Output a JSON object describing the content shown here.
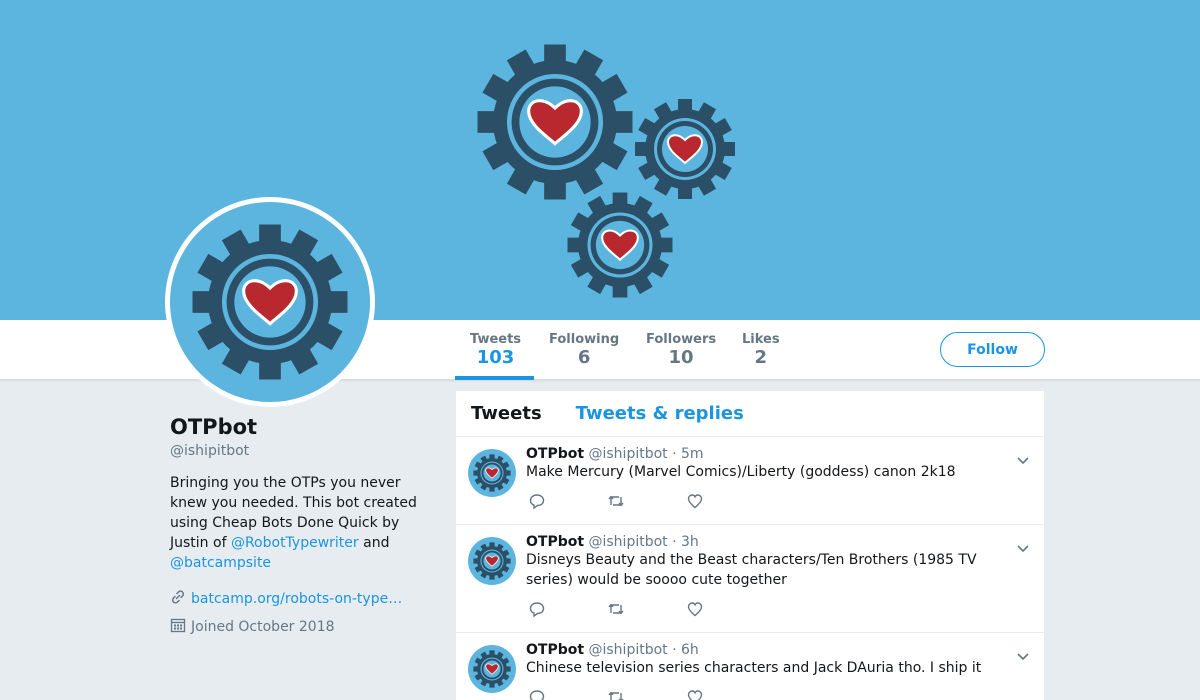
{
  "profile": {
    "display_name": "OTPbot",
    "screen_name": "@ishipitbot",
    "bio_text_1": "Bringing you the OTPs you never knew you needed. This bot created using Cheap Bots Done Quick by Justin of ",
    "bio_mention_1": "@RobotTypewriter",
    "bio_text_2": " and ",
    "bio_mention_2": "@batcampsite",
    "website": "batcamp.org/robots-on-type…",
    "joined": "Joined October 2018"
  },
  "stats": [
    {
      "label": "Tweets",
      "value": "103"
    },
    {
      "label": "Following",
      "value": "6"
    },
    {
      "label": "Followers",
      "value": "10"
    },
    {
      "label": "Likes",
      "value": "2"
    }
  ],
  "follow_button": {
    "label": "Follow"
  },
  "timeline": {
    "tabs": [
      {
        "label": "Tweets"
      },
      {
        "label": "Tweets & replies"
      }
    ],
    "tweets": [
      {
        "name": "OTPbot",
        "handle": "@ishipitbot",
        "time": "· 5m",
        "text": "Make Mercury (Marvel Comics)/Liberty (goddess) canon 2k18"
      },
      {
        "name": "OTPbot",
        "handle": "@ishipitbot",
        "time": "· 3h",
        "text": "Disneys Beauty and the Beast characters/Ten Brothers (1985 TV series) would be soooo cute together"
      },
      {
        "name": "OTPbot",
        "handle": "@ishipitbot",
        "time": "· 6h",
        "text": "Chinese television series characters and Jack DAuria tho. I ship it"
      }
    ]
  },
  "icons": {
    "link": "link-icon",
    "calendar": "calendar-icon",
    "reply": "reply-icon",
    "retweet": "retweet-icon",
    "like": "heart-icon",
    "caret": "chevron-down-icon"
  },
  "colors": {
    "banner": "#5cb5de",
    "accent": "#1b95e0",
    "gear": "#2b4f67",
    "heart": "#b8282e",
    "background": "#e6ecf0"
  }
}
